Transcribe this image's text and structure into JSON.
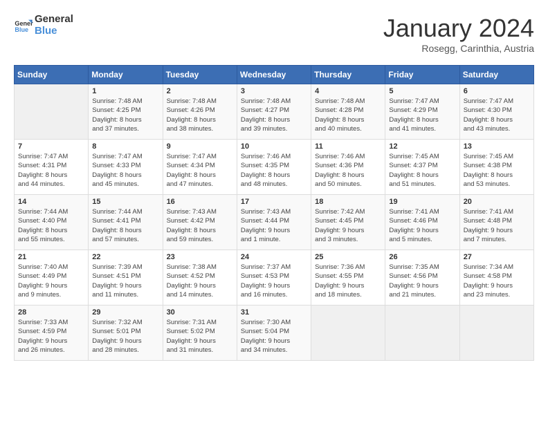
{
  "logo": {
    "line1": "General",
    "line2": "Blue"
  },
  "title": "January 2024",
  "subtitle": "Rosegg, Carinthia, Austria",
  "headers": [
    "Sunday",
    "Monday",
    "Tuesday",
    "Wednesday",
    "Thursday",
    "Friday",
    "Saturday"
  ],
  "weeks": [
    [
      {
        "day": "",
        "info": ""
      },
      {
        "day": "1",
        "info": "Sunrise: 7:48 AM\nSunset: 4:25 PM\nDaylight: 8 hours\nand 37 minutes."
      },
      {
        "day": "2",
        "info": "Sunrise: 7:48 AM\nSunset: 4:26 PM\nDaylight: 8 hours\nand 38 minutes."
      },
      {
        "day": "3",
        "info": "Sunrise: 7:48 AM\nSunset: 4:27 PM\nDaylight: 8 hours\nand 39 minutes."
      },
      {
        "day": "4",
        "info": "Sunrise: 7:48 AM\nSunset: 4:28 PM\nDaylight: 8 hours\nand 40 minutes."
      },
      {
        "day": "5",
        "info": "Sunrise: 7:47 AM\nSunset: 4:29 PM\nDaylight: 8 hours\nand 41 minutes."
      },
      {
        "day": "6",
        "info": "Sunrise: 7:47 AM\nSunset: 4:30 PM\nDaylight: 8 hours\nand 43 minutes."
      }
    ],
    [
      {
        "day": "7",
        "info": "Sunrise: 7:47 AM\nSunset: 4:31 PM\nDaylight: 8 hours\nand 44 minutes."
      },
      {
        "day": "8",
        "info": "Sunrise: 7:47 AM\nSunset: 4:33 PM\nDaylight: 8 hours\nand 45 minutes."
      },
      {
        "day": "9",
        "info": "Sunrise: 7:47 AM\nSunset: 4:34 PM\nDaylight: 8 hours\nand 47 minutes."
      },
      {
        "day": "10",
        "info": "Sunrise: 7:46 AM\nSunset: 4:35 PM\nDaylight: 8 hours\nand 48 minutes."
      },
      {
        "day": "11",
        "info": "Sunrise: 7:46 AM\nSunset: 4:36 PM\nDaylight: 8 hours\nand 50 minutes."
      },
      {
        "day": "12",
        "info": "Sunrise: 7:45 AM\nSunset: 4:37 PM\nDaylight: 8 hours\nand 51 minutes."
      },
      {
        "day": "13",
        "info": "Sunrise: 7:45 AM\nSunset: 4:38 PM\nDaylight: 8 hours\nand 53 minutes."
      }
    ],
    [
      {
        "day": "14",
        "info": "Sunrise: 7:44 AM\nSunset: 4:40 PM\nDaylight: 8 hours\nand 55 minutes."
      },
      {
        "day": "15",
        "info": "Sunrise: 7:44 AM\nSunset: 4:41 PM\nDaylight: 8 hours\nand 57 minutes."
      },
      {
        "day": "16",
        "info": "Sunrise: 7:43 AM\nSunset: 4:42 PM\nDaylight: 8 hours\nand 59 minutes."
      },
      {
        "day": "17",
        "info": "Sunrise: 7:43 AM\nSunset: 4:44 PM\nDaylight: 9 hours\nand 1 minute."
      },
      {
        "day": "18",
        "info": "Sunrise: 7:42 AM\nSunset: 4:45 PM\nDaylight: 9 hours\nand 3 minutes."
      },
      {
        "day": "19",
        "info": "Sunrise: 7:41 AM\nSunset: 4:46 PM\nDaylight: 9 hours\nand 5 minutes."
      },
      {
        "day": "20",
        "info": "Sunrise: 7:41 AM\nSunset: 4:48 PM\nDaylight: 9 hours\nand 7 minutes."
      }
    ],
    [
      {
        "day": "21",
        "info": "Sunrise: 7:40 AM\nSunset: 4:49 PM\nDaylight: 9 hours\nand 9 minutes."
      },
      {
        "day": "22",
        "info": "Sunrise: 7:39 AM\nSunset: 4:51 PM\nDaylight: 9 hours\nand 11 minutes."
      },
      {
        "day": "23",
        "info": "Sunrise: 7:38 AM\nSunset: 4:52 PM\nDaylight: 9 hours\nand 14 minutes."
      },
      {
        "day": "24",
        "info": "Sunrise: 7:37 AM\nSunset: 4:53 PM\nDaylight: 9 hours\nand 16 minutes."
      },
      {
        "day": "25",
        "info": "Sunrise: 7:36 AM\nSunset: 4:55 PM\nDaylight: 9 hours\nand 18 minutes."
      },
      {
        "day": "26",
        "info": "Sunrise: 7:35 AM\nSunset: 4:56 PM\nDaylight: 9 hours\nand 21 minutes."
      },
      {
        "day": "27",
        "info": "Sunrise: 7:34 AM\nSunset: 4:58 PM\nDaylight: 9 hours\nand 23 minutes."
      }
    ],
    [
      {
        "day": "28",
        "info": "Sunrise: 7:33 AM\nSunset: 4:59 PM\nDaylight: 9 hours\nand 26 minutes."
      },
      {
        "day": "29",
        "info": "Sunrise: 7:32 AM\nSunset: 5:01 PM\nDaylight: 9 hours\nand 28 minutes."
      },
      {
        "day": "30",
        "info": "Sunrise: 7:31 AM\nSunset: 5:02 PM\nDaylight: 9 hours\nand 31 minutes."
      },
      {
        "day": "31",
        "info": "Sunrise: 7:30 AM\nSunset: 5:04 PM\nDaylight: 9 hours\nand 34 minutes."
      },
      {
        "day": "",
        "info": ""
      },
      {
        "day": "",
        "info": ""
      },
      {
        "day": "",
        "info": ""
      }
    ]
  ]
}
